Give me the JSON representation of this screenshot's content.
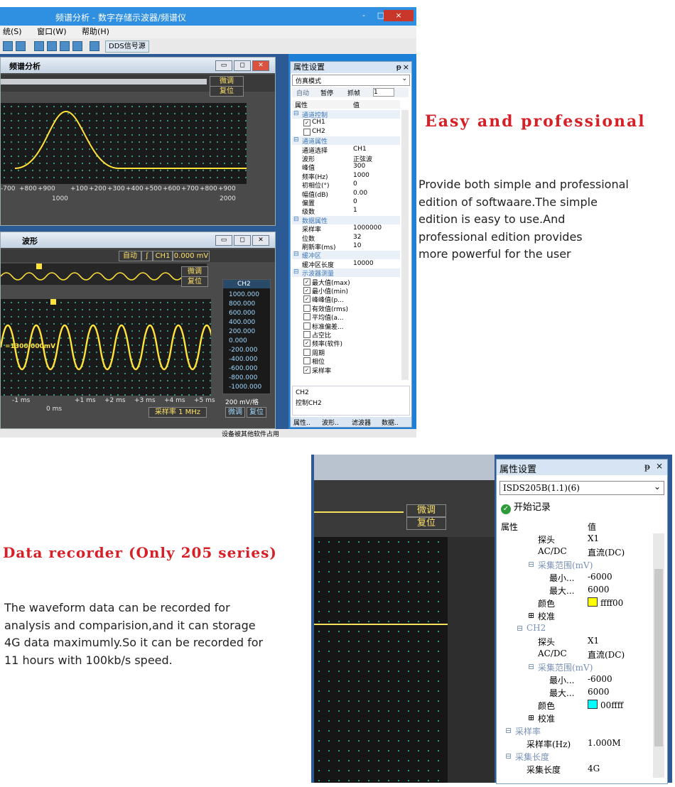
{
  "top_window": {
    "title": "频谱分析 - 数字存储示波器/频谱仪",
    "window_buttons": [
      "-",
      "□",
      "×"
    ],
    "menu": [
      "统(S)",
      "窗口(W)",
      "帮助(H)"
    ],
    "toolbar_dds": "DDS信号源",
    "spectrum_panel": {
      "title": "频谱分析",
      "fine_tune": "微调",
      "reset": "复位",
      "x_ticks": [
        "-700",
        "+800",
        "+900",
        "+100",
        "+200",
        "+300",
        "+400",
        "+500",
        "+600",
        "+700",
        "+800",
        "+900"
      ],
      "x_labels": [
        "1000",
        "2000"
      ]
    },
    "wave_panel": {
      "title": "波形",
      "auto": "自动",
      "trigger_icon": "rising-edge-icon",
      "ch1_btn": "CH1",
      "level": "0.000 mV",
      "fine_tune": "微调",
      "reset": "复位",
      "marker": "=1300.000mV",
      "t_ticks": [
        "-1 ms",
        "+1 ms",
        "+2 ms",
        "+3 ms",
        "+4 ms",
        "+5 ms"
      ],
      "t_zero": "0 ms",
      "ch2": {
        "label": "CH2",
        "scale": [
          "1000.000",
          "800.000",
          "600.000",
          "400.000",
          "200.000",
          "0.000",
          "-200.000",
          "-400.000",
          "-600.000",
          "-800.000",
          "-1000.000"
        ],
        "per_div": "200 mV/格",
        "fine_tune": "微调",
        "reset": "复位"
      },
      "sample_rate": "采样率 1 MHz"
    },
    "properties": {
      "header": "属性设置",
      "mode": "仿真模式",
      "toolbar": [
        "自动",
        "暂停",
        "抓帧",
        "1"
      ],
      "col_prop": "属性",
      "col_val": "值",
      "rows": [
        {
          "type": "group",
          "name": "通道控制"
        },
        {
          "type": "check",
          "name": "CH1",
          "checked": true
        },
        {
          "type": "check",
          "name": "CH2",
          "checked": false
        },
        {
          "type": "group",
          "name": "通道属性"
        },
        {
          "type": "kv",
          "name": "通道选择",
          "value": "CH1"
        },
        {
          "type": "kv",
          "name": "波形",
          "value": "正弦波"
        },
        {
          "type": "kv",
          "name": "峰值",
          "value": "300"
        },
        {
          "type": "kv",
          "name": "频率(Hz)",
          "value": "1000"
        },
        {
          "type": "kv",
          "name": "初相位(°)",
          "value": "0"
        },
        {
          "type": "kv",
          "name": "幅值(dB)",
          "value": "0.00"
        },
        {
          "type": "kv",
          "name": "偏置",
          "value": "0"
        },
        {
          "type": "kv",
          "name": "级数",
          "value": "1"
        },
        {
          "type": "group",
          "name": "数据属性"
        },
        {
          "type": "kv",
          "name": "采样率",
          "value": "1000000"
        },
        {
          "type": "kv",
          "name": "位数",
          "value": "32"
        },
        {
          "type": "kv",
          "name": "刷新率(ms)",
          "value": "10"
        },
        {
          "type": "group",
          "name": "缓冲区"
        },
        {
          "type": "kv",
          "name": "缓冲区长度",
          "value": "10000"
        },
        {
          "type": "group",
          "name": "示波器测量"
        },
        {
          "type": "check",
          "name": "最大值(max)",
          "checked": true
        },
        {
          "type": "check",
          "name": "最小值(min)",
          "checked": true
        },
        {
          "type": "check",
          "name": "峰峰值(p...",
          "checked": true
        },
        {
          "type": "check",
          "name": "有效值(rms)",
          "checked": false
        },
        {
          "type": "check",
          "name": "平均值(a...",
          "checked": false
        },
        {
          "type": "check",
          "name": "标准偏差...",
          "checked": false
        },
        {
          "type": "check",
          "name": "占空比",
          "checked": false
        },
        {
          "type": "check",
          "name": "频率(软件)",
          "checked": true
        },
        {
          "type": "check",
          "name": "周期",
          "checked": false
        },
        {
          "type": "check",
          "name": "相位",
          "checked": false
        },
        {
          "type": "check",
          "name": "采样率",
          "checked": true
        }
      ],
      "desc_title": "CH2",
      "desc_text": "控制CH2",
      "tabs": [
        "属性..",
        "波形..",
        "滤波器",
        "数据.."
      ]
    },
    "status": "设备被其他软件占用"
  },
  "section1": {
    "heading": "Easy and professional",
    "lines": [
      "Provide both simple and professional",
      "edition of softwaare.The simple",
      "edition is easy to use.And",
      "professional edition provides",
      "more powerful for the user"
    ]
  },
  "section2": {
    "heading": "Data recorder (Only 205 series)",
    "lines": [
      "The waveform data can be recorded for",
      "analysis and comparision,and it can storage",
      "4G data maximumly.So it can be recorded for",
      "11 hours with 100kb/s speed."
    ]
  },
  "bottom_window": {
    "fine_tune": "微调",
    "reset": "复位",
    "properties": {
      "header": "属性设置",
      "pin": "ᵽ",
      "close": "×",
      "device": "ISDS205B(1.1)(6)",
      "start": "开始记录",
      "col_prop": "属性",
      "col_val": "值",
      "rows": [
        {
          "type": "kv",
          "indent": 1,
          "name": "探头",
          "value": "X1"
        },
        {
          "type": "kv",
          "indent": 1,
          "name": "AC/DC",
          "value": "直流(DC)"
        },
        {
          "type": "group",
          "indent": 1,
          "name": "采集范围(mV)"
        },
        {
          "type": "kv",
          "indent": 2,
          "name": "最小...",
          "value": "-6000"
        },
        {
          "type": "kv",
          "indent": 2,
          "name": "最大...",
          "value": "6000"
        },
        {
          "type": "color",
          "indent": 1,
          "name": "颜色",
          "value": "ffff00",
          "color": "#ffff00"
        },
        {
          "type": "plus",
          "indent": 1,
          "name": "校准"
        },
        {
          "type": "group",
          "indent": 0,
          "name": "CH2"
        },
        {
          "type": "kv",
          "indent": 1,
          "name": "探头",
          "value": "X1"
        },
        {
          "type": "kv",
          "indent": 1,
          "name": "AC/DC",
          "value": "直流(DC)"
        },
        {
          "type": "group",
          "indent": 1,
          "name": "采集范围(mV)"
        },
        {
          "type": "kv",
          "indent": 2,
          "name": "最小...",
          "value": "-6000"
        },
        {
          "type": "kv",
          "indent": 2,
          "name": "最大...",
          "value": "6000"
        },
        {
          "type": "color",
          "indent": 1,
          "name": "颜色",
          "value": "00ffff",
          "color": "#00ffff"
        },
        {
          "type": "plus",
          "indent": 1,
          "name": "校准"
        },
        {
          "type": "group",
          "indent": -1,
          "name": "采样率"
        },
        {
          "type": "kv",
          "indent": 0,
          "name": "采样率(Hz)",
          "value": "1.000M"
        },
        {
          "type": "group",
          "indent": -1,
          "name": "采集长度"
        },
        {
          "type": "kv",
          "indent": 0,
          "name": "采集长度",
          "value": "4G"
        }
      ]
    }
  }
}
